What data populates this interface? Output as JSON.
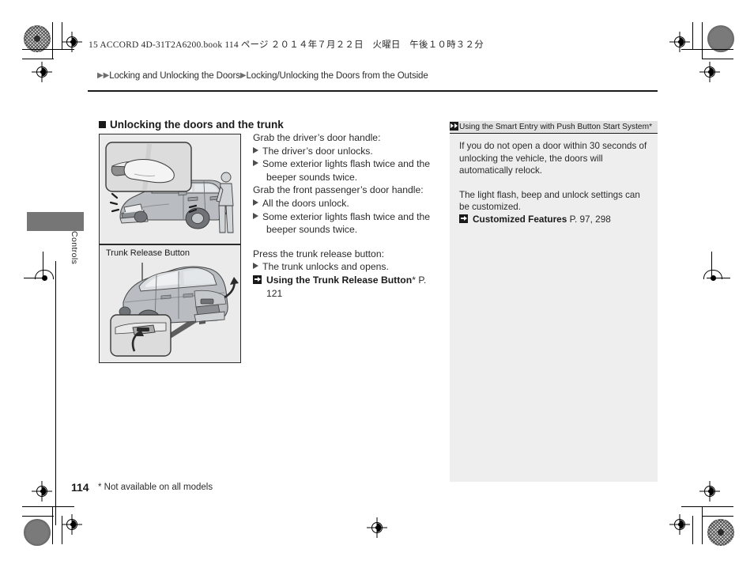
{
  "book_header": "15 ACCORD 4D-31T2A6200.book  114 ページ  ２０１４年７月２２日　火曜日　午後１０時３２分",
  "breadcrumb": {
    "level1": "Locking and Unlocking the Doors",
    "level2": "Locking/Unlocking the Doors from the Outside"
  },
  "side_tab": {
    "label": "Controls"
  },
  "section": {
    "heading": "Unlocking the doors and the trunk"
  },
  "figures": {
    "doors": {
      "caption": "",
      "alt": "Hand grabbing the driver's door handle with inset close-up; exterior lights flashing"
    },
    "trunk": {
      "caption": "Trunk Release Button",
      "alt": "Rear view of sedan with trunk release button inset and upward arrow"
    }
  },
  "instructions": {
    "block1": {
      "lead": "Grab the driver’s door handle:",
      "items": [
        "The driver’s door unlocks.",
        "Some exterior lights flash twice and the beeper sounds twice."
      ]
    },
    "block2": {
      "lead": "Grab the front passenger’s door handle:",
      "items": [
        "All the doors unlock.",
        "Some exterior lights flash twice and the beeper sounds twice."
      ]
    },
    "block3": {
      "lead": "Press the trunk release button:",
      "items": [
        "The trunk unlocks and opens."
      ],
      "xref": {
        "title": "Using the Trunk Release Button",
        "asterisk": "*",
        "page": "P. 121"
      }
    }
  },
  "note_panel": {
    "title": "Using the Smart Entry with Push Button Start System",
    "title_asterisk": "*",
    "paragraph1": "If you do not open a door within 30 seconds of unlocking the vehicle, the doors will automatically relock.",
    "paragraph2": "The light flash, beep and unlock settings can be customized.",
    "xref": {
      "title": "Customized Features",
      "page": "P. 97, 298"
    }
  },
  "footer": {
    "page_number": "114",
    "footnote": "* Not available on all models"
  },
  "colors": {
    "text": "#2b2b2b",
    "heading": "#1a1a1a",
    "note_background": "#eeeeee",
    "note_header_background": "#e2e2e2",
    "side_tab": "#767676",
    "figure_background": "#ebebeb"
  }
}
